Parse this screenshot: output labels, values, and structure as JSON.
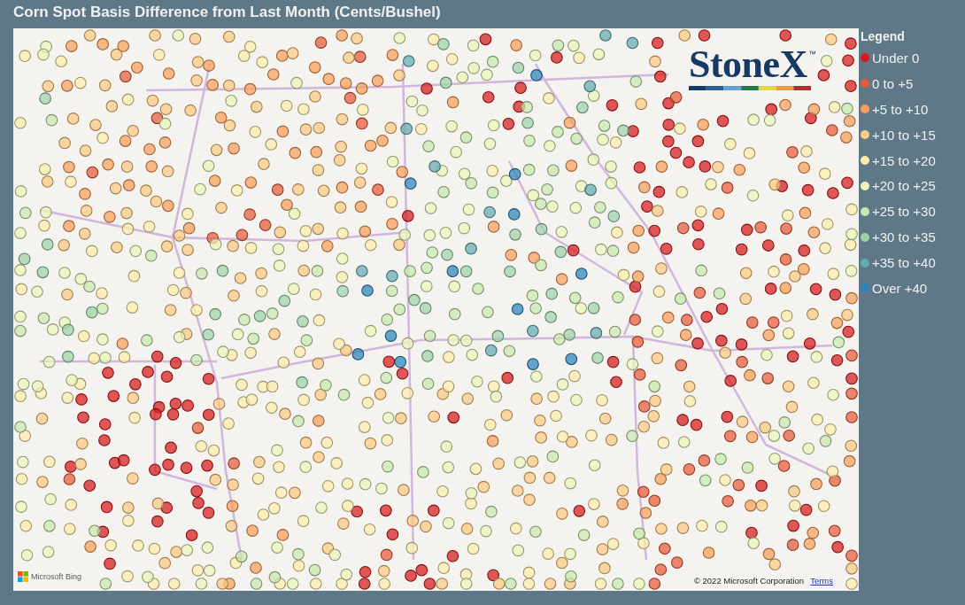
{
  "title": "Corn Spot Basis Difference from Last Month (Cents/Bushel)",
  "map": {
    "logo": {
      "name": "StoneX",
      "mark": "™"
    },
    "provider": "Microsoft Bing",
    "copyright": "© 2022 Microsoft Corporation",
    "terms_link": "Terms"
  },
  "legend": {
    "title": "Legend",
    "items": [
      {
        "label": "Under 0",
        "color": "#d7191c"
      },
      {
        "label": "0 to +5",
        "color": "#e85b3a"
      },
      {
        "label": "+5 to +10",
        "color": "#f99e59"
      },
      {
        "label": "+10 to +15",
        "color": "#fec980"
      },
      {
        "label": "+15 to +20",
        "color": "#ffedaa"
      },
      {
        "label": "+20 to +25",
        "color": "#ecf7b9"
      },
      {
        "label": "+25 to +30",
        "color": "#c7e9ad"
      },
      {
        "label": "+30 to +35",
        "color": "#9dd3a7"
      },
      {
        "label": "+35 to +40",
        "color": "#64abb0"
      },
      {
        "label": "Over +40",
        "color": "#2b83ba"
      }
    ]
  }
}
